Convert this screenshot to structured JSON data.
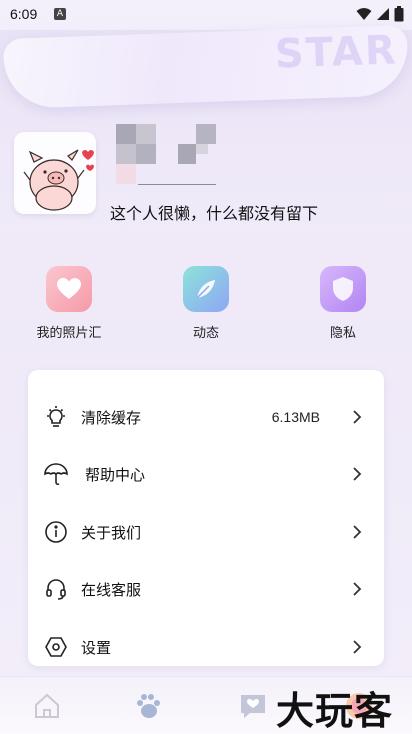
{
  "status_bar": {
    "time": "6:09",
    "app_icon": "A"
  },
  "header": {
    "banner_text": "STAR",
    "bio": "这个人很懒，什么都没有留下"
  },
  "quick_actions": [
    {
      "label": "我的照片汇",
      "icon": "photo-heart-icon"
    },
    {
      "label": "动态",
      "icon": "feather-icon"
    },
    {
      "label": "隐私",
      "icon": "shield-icon"
    }
  ],
  "menu": [
    {
      "label": "清除缓存",
      "value": "6.13MB",
      "icon": "bulb-icon"
    },
    {
      "label": "帮助中心",
      "value": "",
      "icon": "umbrella-icon"
    },
    {
      "label": "关于我们",
      "value": "",
      "icon": "info-icon"
    },
    {
      "label": "在线客服",
      "value": "",
      "icon": "headset-icon"
    },
    {
      "label": "设置",
      "value": "",
      "icon": "settings-hex-icon"
    }
  ],
  "bottom_nav": [
    {
      "icon": "home-icon"
    },
    {
      "icon": "paw-icon"
    },
    {
      "icon": "message-icon"
    },
    {
      "icon": "profile-icon"
    }
  ],
  "watermark": "大玩客",
  "colors": {
    "accent_pink": "#f7a7b4",
    "accent_purple": "#b98af0",
    "accent_blue": "#7fb4f6"
  }
}
